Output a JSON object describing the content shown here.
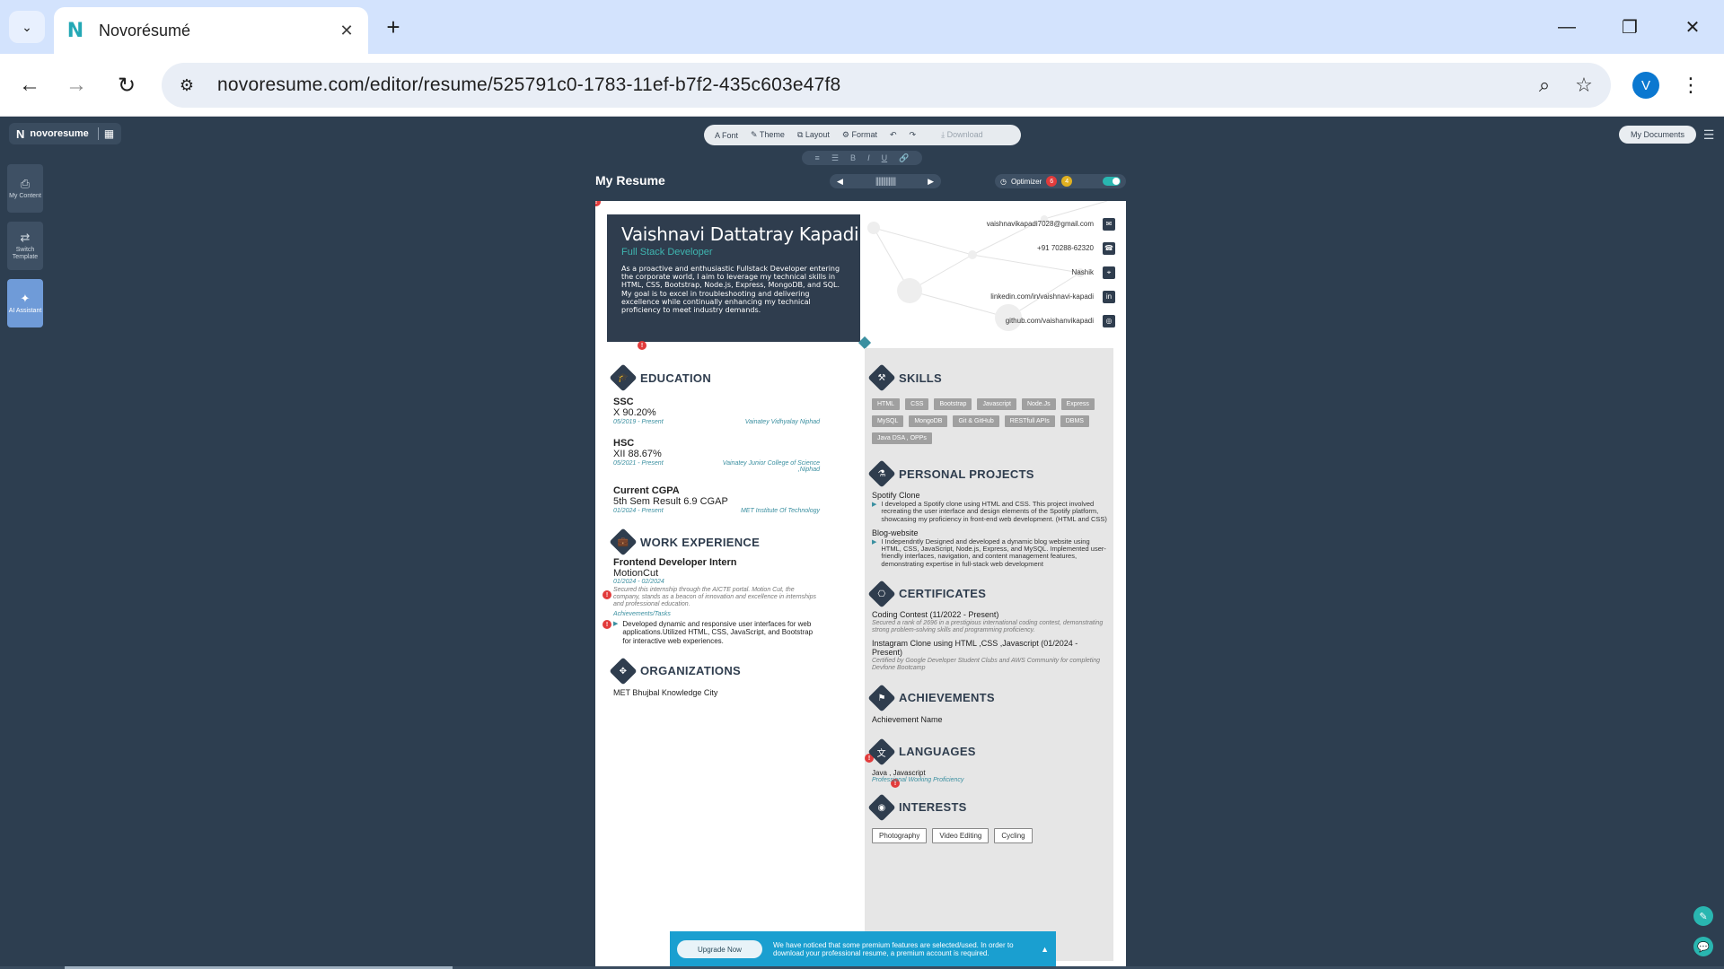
{
  "browser": {
    "tab_title": "Novorésumé",
    "tab_favicon": "N",
    "new_tab": "+",
    "close_tab": "✕",
    "url": "novoresume.com/editor/resume/525791c0-1783-11ef-b7f2-435c603e47f8",
    "profile_initial": "V",
    "controls": {
      "minimize": "—",
      "restore": "❐",
      "close": "✕"
    }
  },
  "app": {
    "logo": "novoresume",
    "toolbar": [
      "Font",
      "Theme",
      "Layout",
      "Format"
    ],
    "download": "Download",
    "my_documents": "My Documents",
    "side_buttons": [
      {
        "label": "My Content",
        "icon": "document-icon"
      },
      {
        "label": "Switch Template",
        "icon": "template-icon"
      },
      {
        "label": "AI Assistant",
        "icon": "ai-icon"
      }
    ],
    "page_title": "My Resume",
    "optimizer": {
      "label": "Optimizer",
      "errors": "6",
      "warnings": "4"
    }
  },
  "resume": {
    "name": "Vaishnavi Dattatray Kapadi",
    "role": "Full Stack Developer",
    "summary": "As a proactive and enthusiastic Fullstack Developer entering the corporate world, I aim to leverage my technical skills in HTML, CSS, Bootstrap, Node.js, Express, MongoDB, and SQL. My goal is to excel in troubleshooting and delivering excellence while continually enhancing my technical proficiency to meet industry demands.",
    "contacts": [
      {
        "text": "vaishnavikapadi7028@gmail.com",
        "icon": "✉"
      },
      {
        "text": "+91 70288-62320",
        "icon": "☎"
      },
      {
        "text": "Nashik",
        "icon": "⌖"
      },
      {
        "text": "linkedin.com/in/vaishnavi-kapadi",
        "icon": "in"
      },
      {
        "text": "github.com/vaishanvikapadi",
        "icon": "◎"
      }
    ],
    "sections": {
      "education": "EDUCATION",
      "work": "WORK EXPERIENCE",
      "organizations": "ORGANIZATIONS",
      "skills": "SKILLS",
      "projects": "PERSONAL PROJECTS",
      "certificates": "CERTIFICATES",
      "achievements": "ACHIEVEMENTS",
      "languages": "LANGUAGES",
      "interests": "INTERESTS"
    },
    "education": [
      {
        "title": "SSC",
        "sub": "X 90.20%",
        "date": "05/2019 - Present",
        "school": "Vainatey Vidhyalay Niphad"
      },
      {
        "title": "HSC",
        "sub": "XII 88.67%",
        "date": "05/2021 - Present",
        "school": "Vainatey Junior College of Science ,Niphad"
      },
      {
        "title": "Current CGPA",
        "sub": "5th Sem Result 6.9 CGAP",
        "date": "01/2024 - Present",
        "school": "MET Institute Of Technology"
      }
    ],
    "work": {
      "title": "Frontend Developer Intern",
      "company": "MotionCut",
      "date": "01/2024 - 02/2024",
      "desc": "Secured this internship through the AICTE portal. Motion Cut, the company, stands as a beacon of innovation and excellence in internships and professional education.",
      "tasks_label": "Achievements/Tasks",
      "task": "Developed dynamic and responsive user interfaces for web applications.Utilized HTML, CSS, JavaScript, and Bootstrap for interactive web experiences."
    },
    "organization": "MET Bhujbal Knowledge City",
    "skills": [
      "HTML",
      "CSS",
      "Bootstrap",
      "Javascript",
      "Node.Js",
      "Express",
      "MySQL",
      "MongoDB",
      "Git & GitHub",
      "RESTfull APIs",
      "DBMS",
      "Java DSA , OPPs"
    ],
    "projects": [
      {
        "name": "Spotify Clone",
        "desc": "I developed a Spotify clone using HTML and CSS. This project involved recreating the user interface and design elements of the Spotify platform, showcasing my proficiency in front-end web development. (HTML and CSS)"
      },
      {
        "name": "Blog-website",
        "desc": "I Independntly Designed and developed a dynamic blog website using HTML, CSS, JavaScript, Node.js, Express, and MySQL. Implemented user-friendly interfaces, navigation, and content management features, demonstrating expertise in full-stack web development"
      }
    ],
    "certificates": [
      {
        "name": "Coding Contest (11/2022 - Present)",
        "desc": "Secured a rank of 2696 in a prestigious international coding contest, demonstrating strong problem-solving skills and programming proficiency."
      },
      {
        "name": "Instagram Clone using HTML ,CSS ,Javascript (01/2024 - Present)",
        "desc": "Certified by Google Developer Student Clubs and AWS Community for completing Devfone Bootcamp"
      }
    ],
    "achievement": "Achievement Name",
    "language": {
      "name": "Java , Javascript",
      "level": "Professional Working Proficiency"
    },
    "interests": [
      "Photography",
      "Video Editing",
      "Cycling"
    ]
  },
  "banner": {
    "button": "Upgrade Now",
    "text": "We have noticed that some premium features are selected/used. In order to download your professional resume, a premium account is required."
  },
  "colors": {
    "accent": "#3a8fa0",
    "dark": "#2f3d4e",
    "banner": "#1a9fd0",
    "warning": "#e23b3b"
  }
}
